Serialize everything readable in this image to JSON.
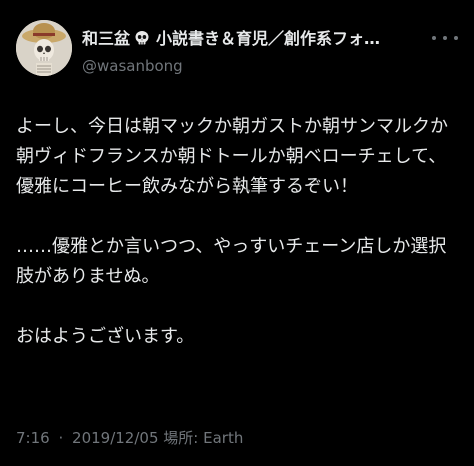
{
  "user": {
    "display_name": "和三盆",
    "display_name_suffix": "小説書き＆育児／創作系フォ…",
    "name_emoji_icon": "skull-emoji-icon",
    "handle": "@wasanbong",
    "avatar_icon": "skeleton-avatar"
  },
  "more_icon": "more-options-icon",
  "tweet": {
    "paragraphs": [
      "よーし、今日は朝マックか朝ガストか朝サンマルクか朝ヴィドフランスか朝ドトールか朝ベローチェして、優雅にコーヒー飲みながら執筆するぞい！",
      "……優雅とか言いつつ、やっすいチェーン店しか選択肢がありませぬ。",
      "おはようございます。"
    ]
  },
  "meta": {
    "time": "7:16",
    "separator": "·",
    "date": "2019/12/05",
    "location_label": "場所: Earth"
  },
  "colors": {
    "background": "#000000",
    "primary_text": "#e7e9ea",
    "secondary_text": "#71767b"
  }
}
